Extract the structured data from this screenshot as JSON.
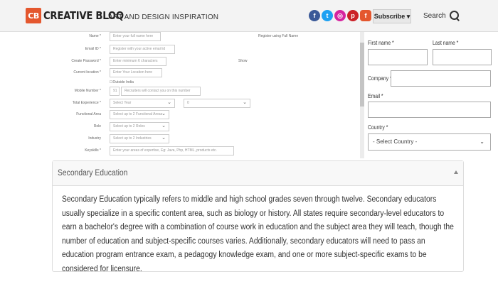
{
  "header": {
    "logo_mark": "CB",
    "logo_text": "CREATIVE BLOQ",
    "tagline": "ART AND DESIGN INSPIRATION",
    "social": [
      {
        "icon": "facebook-icon",
        "glyph": "f",
        "color": "#3b5998"
      },
      {
        "icon": "twitter-icon",
        "glyph": "t",
        "color": "#1da1f2"
      },
      {
        "icon": "instagram-icon",
        "glyph": "◎",
        "color": "#d6249f"
      },
      {
        "icon": "pinterest-icon",
        "glyph": "p",
        "color": "#cb2027"
      },
      {
        "icon": "flipboard-icon",
        "glyph": "f",
        "color": "#e4572e"
      }
    ],
    "subscribe_label": "Subscribe ▾",
    "search_label": "Search"
  },
  "left_form": {
    "name_label": "Name *",
    "name_placeholder": "Enter your full name here",
    "name_note": "Register using Full Name",
    "email_label": "Email ID *",
    "email_placeholder": "Register with your active email id",
    "password_label": "Create Password *",
    "password_placeholder": "Enter minimum 6 characters",
    "password_note": "Show",
    "location_label": "Current location *",
    "location_placeholder": "Enter Your Location here",
    "outside_india": "Outside India",
    "mobile_label": "Mobile Number *",
    "mobile_code": "91",
    "mobile_placeholder": "Recruiters will contact you on this number",
    "experience_label": "Total Experience *",
    "experience_year": "Select Year",
    "experience_month": "0",
    "functional_label": "Functional Area",
    "functional_value": "Select up to 2 Functional Areas",
    "role_label": "Role",
    "role_value": "Select up to 2 Roles",
    "industry_label": "Industry",
    "industry_value": "Select up to 2 Industries",
    "keyskills_label": "Keyskills *",
    "keyskills_placeholder": "Enter your areas of expertise, Eg: Java, Php, HTML, products etc."
  },
  "right_form": {
    "first_name_label": "First name *",
    "last_name_label": "Last name *",
    "company_label": "Company *",
    "email_label": "Email *",
    "country_label": "Country *",
    "country_value": "- Select Country -",
    "country_chevron": "⌄"
  },
  "accordion": {
    "title": "Secondary Education",
    "body": "Secondary Education typically refers to middle and high school grades seven through twelve. Secondary educators usually specialize in a specific content area, such as biology or history. All states require secondary-level educators to earn a bachelor's degree with a combination of course work in education and the subject area they will teach, though the number of education and subject-specific courses varies. Additionally, secondary educators will need to pass an education program entrance exam, a pedagogy knowledge exam, and one or more subject-specific exams to be considered for licensure."
  }
}
